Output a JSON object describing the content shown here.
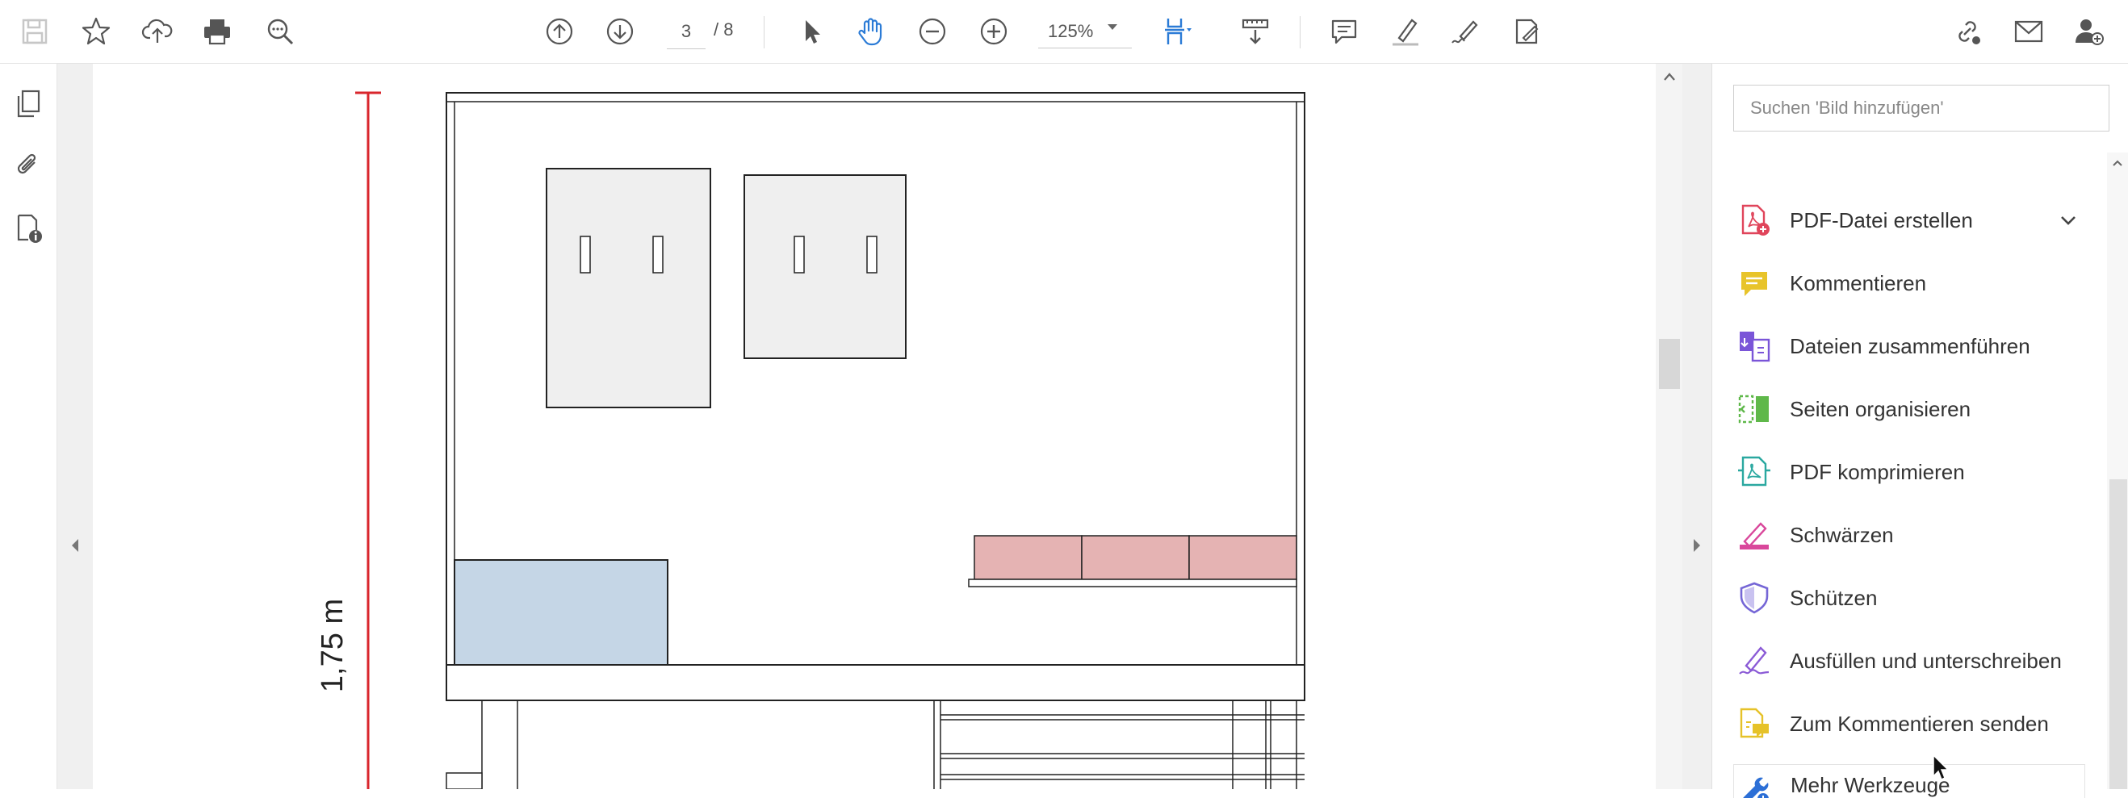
{
  "toolbar": {
    "page_current": "3",
    "page_total": "/ 8",
    "zoom": "125%",
    "icons": [
      "save-icon",
      "bookmark-star-icon",
      "upload-cloud-icon",
      "print-icon",
      "find-zoom-icon",
      "page-up-icon",
      "page-down-icon",
      "select-cursor-icon",
      "hand-tool-icon",
      "zoom-out-icon",
      "zoom-in-icon",
      "fit-page-icon",
      "scroll-mode-icon",
      "comment-icon",
      "highlight-icon",
      "sign-pen-icon",
      "fill-sign-icon",
      "share-link-icon",
      "email-icon",
      "add-user-icon"
    ]
  },
  "drawing": {
    "dimension_label": "1,75 m"
  },
  "tools_panel": {
    "search_placeholder": "Suchen 'Bild hinzufügen'",
    "items": [
      {
        "label": "PDF-Datei erstellen",
        "icon": "create-pdf-icon",
        "color": "#e0455b"
      },
      {
        "label": "Kommentieren",
        "icon": "comment-tool-icon",
        "color": "#e8c42a"
      },
      {
        "label": "Dateien zusammenführen",
        "icon": "merge-files-icon",
        "color": "#7a55d8"
      },
      {
        "label": "Seiten organisieren",
        "icon": "organize-pages-icon",
        "color": "#5fb84a"
      },
      {
        "label": "PDF komprimieren",
        "icon": "compress-pdf-icon",
        "color": "#2aa8a0"
      },
      {
        "label": "Schwärzen",
        "icon": "redact-icon",
        "color": "#d9479b"
      },
      {
        "label": "Schützen",
        "icon": "protect-shield-icon",
        "color": "#7566d6"
      },
      {
        "label": "Ausfüllen und unterschreiben",
        "icon": "fill-sign-tool-icon",
        "color": "#8b5bd6"
      },
      {
        "label": "Zum Kommentieren senden",
        "icon": "send-comment-icon",
        "color": "#e6c229"
      },
      {
        "label": "Mehr Werkzeuge",
        "icon": "more-tools-icon",
        "color": "#2c6fd6"
      }
    ]
  }
}
